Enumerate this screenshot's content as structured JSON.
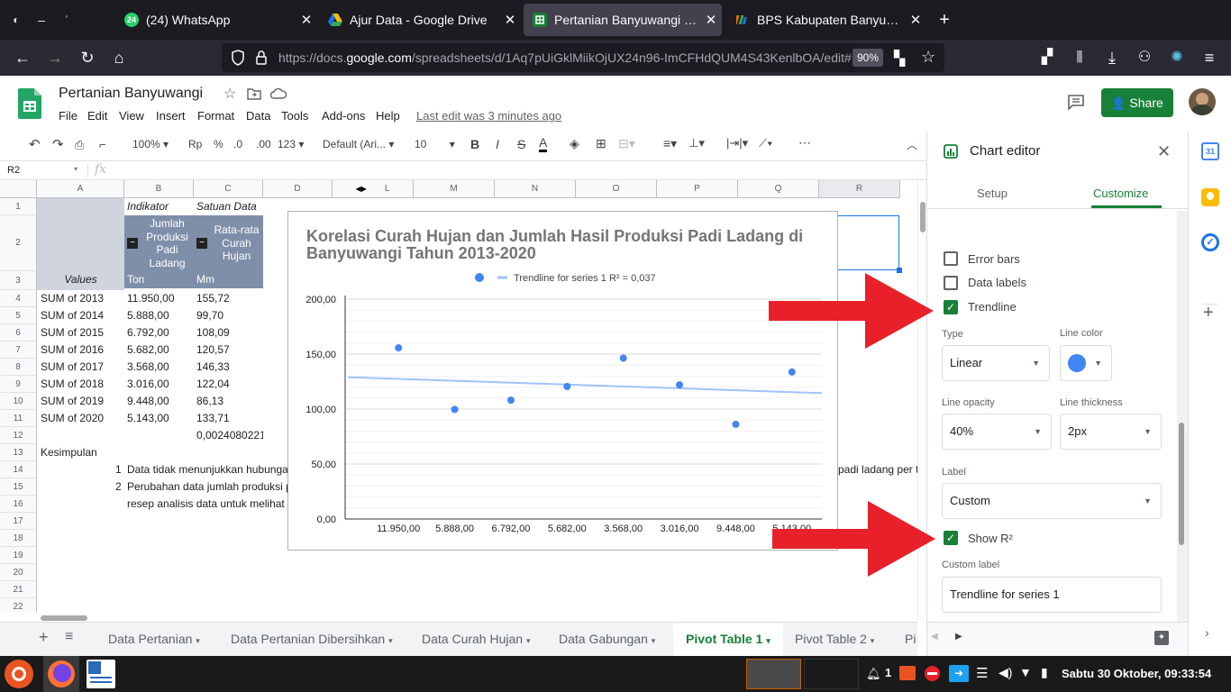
{
  "browser": {
    "tabs": [
      {
        "label": "(24) WhatsApp",
        "icon": "whatsapp-icon",
        "color": "#25d366",
        "active": false
      },
      {
        "label": "Ajur Data - Google Drive",
        "icon": "google-drive-icon",
        "color": "#fbbc04",
        "active": false
      },
      {
        "label": "Pertanian Banyuwangi - Goo",
        "icon": "google-sheets-icon",
        "color": "#188038",
        "active": true
      },
      {
        "label": "BPS Kabupaten Banyuwangi",
        "icon": "bps-icon",
        "color": "#e37400",
        "active": false
      }
    ],
    "url_prefix": "https://docs.",
    "url_domain": "google.com",
    "url_path": "/spreadsheets/d/1Aq7pUiGklMiikOjUX24n96-ImCFHdQUM4S43KenlbOA/edit#",
    "zoom": "90%"
  },
  "app": {
    "title": "Pertanian Banyuwangi",
    "menus": [
      "File",
      "Edit",
      "View",
      "Insert",
      "Format",
      "Data",
      "Tools",
      "Add-ons",
      "Help"
    ],
    "last_edit": "Last edit was 3 minutes ago",
    "share_label": "Share",
    "accent": "#188038"
  },
  "toolbar": {
    "zoom": "100%",
    "currency": "Rp",
    "percent": "%",
    "dec_less": ".0",
    "dec_more": ".00",
    "format_more": "123",
    "font": "Default (Ari...",
    "font_size": "10",
    "bold": "B",
    "italic": "I",
    "strike": "S",
    "text_color": "A"
  },
  "formula": {
    "cell_ref": "R2",
    "fx": "fx"
  },
  "grid": {
    "columns": [
      "A",
      "B",
      "C",
      "D",
      "L",
      "M",
      "N",
      "O",
      "P",
      "Q",
      "R"
    ],
    "rows": [
      "1",
      "2",
      "3",
      "4",
      "5",
      "6",
      "7",
      "8",
      "9",
      "10",
      "11",
      "12",
      "13",
      "14",
      "15",
      "16",
      "17",
      "18",
      "19",
      "20",
      "21",
      "22"
    ],
    "header_indikator": "Indikator",
    "header_satuan": "Satuan Data",
    "col_b_header": "Jumlah Produksi Padi Ladang",
    "col_c_header": "Rata-rata Curah Hujan",
    "values_label": "Values",
    "unit_b": "Ton",
    "unit_c": "Mm",
    "collapse_symbol": "−",
    "data_rows": [
      {
        "label": "SUM of 2013",
        "b": "11.950,00",
        "c": "155,72"
      },
      {
        "label": "SUM of 2014",
        "b": "5.888,00",
        "c": "99,70"
      },
      {
        "label": "SUM of 2015",
        "b": "6.792,00",
        "c": "108,09"
      },
      {
        "label": "SUM of 2016",
        "b": "5.682,00",
        "c": "120,57"
      },
      {
        "label": "SUM of 2017",
        "b": "3.568,00",
        "c": "146,33"
      },
      {
        "label": "SUM of 2018",
        "b": "3.016,00",
        "c": "122,04"
      },
      {
        "label": "SUM of 2019",
        "b": "9.448,00",
        "c": "86,13"
      },
      {
        "label": "SUM of 2020",
        "b": "5.143,00",
        "c": "133,71"
      }
    ],
    "c12": "0,0024080221",
    "a13": "Kesimpulan",
    "n14": "1",
    "t14": "Data tidak menunjukkan hubunga",
    "t14_right": "padi ladang per t",
    "n15": "2",
    "t15": "Perubahan data jumlah produksi p",
    "t16": "resep analisis data untuk melihat l"
  },
  "chart_data": {
    "type": "scatter",
    "title": "Korelasi Curah Hujan dan Jumlah Hasil Produksi Padi Ladang di Banyuwangi Tahun 2013-2020",
    "legend": "Trendline for series 1 R² = 0,037",
    "legend_position": "top",
    "categories": [
      "11.950,00",
      "5.888,00",
      "6.792,00",
      "5.682,00",
      "3.568,00",
      "3.016,00",
      "9.448,00",
      "5.143,00"
    ],
    "values": [
      155.72,
      99.7,
      108.09,
      120.57,
      146.33,
      122.04,
      86.13,
      133.71
    ],
    "trendline": {
      "start": 129,
      "end": 114.5
    },
    "yticks": [
      "0,00",
      "50,00",
      "100,00",
      "150,00",
      "200,00"
    ],
    "ylim": [
      0,
      200
    ],
    "grid": true,
    "point_color": "#4285f4",
    "trend_color": "#a1c2fa"
  },
  "editor": {
    "title": "Chart editor",
    "tab_setup": "Setup",
    "tab_customize": "Customize",
    "error_bars": "Error bars",
    "data_labels": "Data labels",
    "trendline": "Trendline",
    "type_label": "Type",
    "type_value": "Linear",
    "line_color_label": "Line color",
    "line_color": "#4285f4",
    "opacity_label": "Line opacity",
    "opacity_value": "40%",
    "thickness_label": "Line thickness",
    "thickness_value": "2px",
    "label_label": "Label",
    "label_value": "Custom",
    "show_r2": "Show R²",
    "custom_label_label": "Custom label",
    "custom_label_value": "Trendline for series 1"
  },
  "sheet_tabs": [
    "Data Pertanian",
    "Data Pertanian Dibersihkan",
    "Data Curah Hujan",
    "Data Gabungan",
    "Pivot Table 1",
    "Pivot Table 2",
    "Pi"
  ],
  "active_sheet_tab": "Pivot Table 1",
  "taskbar": {
    "workspace": "1",
    "clock": "Sabtu 30 Oktober, 09:33:54"
  },
  "annotation_color": "#e8202a"
}
